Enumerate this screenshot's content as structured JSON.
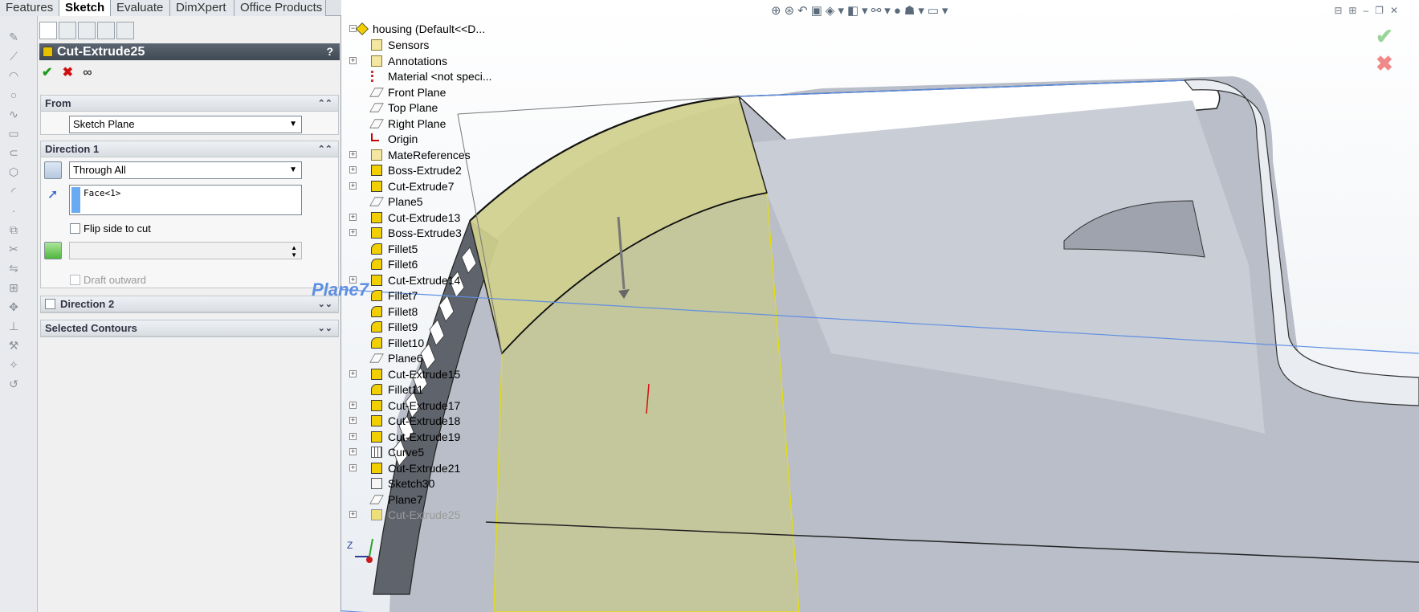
{
  "tabs": [
    {
      "label": "Features",
      "active": false
    },
    {
      "label": "Sketch",
      "active": true
    },
    {
      "label": "Evaluate",
      "active": false
    },
    {
      "label": "DimXpert",
      "active": false
    },
    {
      "label": "Office Products",
      "active": false
    }
  ],
  "property_manager": {
    "title": "Cut-Extrude25",
    "help": "?",
    "from": {
      "header": "From",
      "selected": "Sketch Plane"
    },
    "direction1": {
      "header": "Direction 1",
      "end_condition": "Through All",
      "face_selection": "Face<1>",
      "flip_side_label": "Flip side to cut",
      "draft_outward_label": "Draft outward"
    },
    "direction2": {
      "header": "Direction 2"
    },
    "selected_contours": {
      "header": "Selected Contours"
    }
  },
  "feature_tree": {
    "root": "housing  (Default<<D...",
    "items": [
      {
        "label": "Sensors",
        "icon": "sensor-icon",
        "expand": false
      },
      {
        "label": "Annotations",
        "icon": "annotations-icon",
        "expand": true
      },
      {
        "label": "Material <not speci...",
        "icon": "material-icon",
        "expand": false
      },
      {
        "label": "Front Plane",
        "icon": "plane-icon",
        "expand": false
      },
      {
        "label": "Top Plane",
        "icon": "plane-icon",
        "expand": false
      },
      {
        "label": "Right Plane",
        "icon": "plane-icon",
        "expand": false
      },
      {
        "label": "Origin",
        "icon": "origin-icon",
        "expand": false
      },
      {
        "label": "MateReferences",
        "icon": "folder-icon",
        "expand": true
      },
      {
        "label": "Boss-Extrude2",
        "icon": "extrude-icon",
        "expand": true
      },
      {
        "label": "Cut-Extrude7",
        "icon": "extrude-icon",
        "expand": true
      },
      {
        "label": "Plane5",
        "icon": "plane-icon",
        "expand": false
      },
      {
        "label": "Cut-Extrude13",
        "icon": "extrude-icon",
        "expand": true
      },
      {
        "label": "Boss-Extrude3",
        "icon": "extrude-icon",
        "expand": true
      },
      {
        "label": "Fillet5",
        "icon": "fillet-icon",
        "expand": false
      },
      {
        "label": "Fillet6",
        "icon": "fillet-icon",
        "expand": false
      },
      {
        "label": "Cut-Extrude14",
        "icon": "extrude-icon",
        "expand": true
      },
      {
        "label": "Fillet7",
        "icon": "fillet-icon",
        "expand": false
      },
      {
        "label": "Fillet8",
        "icon": "fillet-icon",
        "expand": false
      },
      {
        "label": "Fillet9",
        "icon": "fillet-icon",
        "expand": false
      },
      {
        "label": "Fillet10",
        "icon": "fillet-icon",
        "expand": false
      },
      {
        "label": "Plane6",
        "icon": "plane-icon",
        "expand": false
      },
      {
        "label": "Cut-Extrude15",
        "icon": "extrude-icon",
        "expand": true
      },
      {
        "label": "Fillet11",
        "icon": "fillet-icon",
        "expand": false
      },
      {
        "label": "Cut-Extrude17",
        "icon": "extrude-icon",
        "expand": true
      },
      {
        "label": "Cut-Extrude18",
        "icon": "extrude-icon",
        "expand": true
      },
      {
        "label": "Cut-Extrude19",
        "icon": "extrude-icon",
        "expand": true
      },
      {
        "label": "Curve5",
        "icon": "curve-icon",
        "expand": true
      },
      {
        "label": "Cut-Extrude21",
        "icon": "extrude-icon",
        "expand": true
      },
      {
        "label": "Sketch30",
        "icon": "sketch-icon",
        "expand": false
      },
      {
        "label": "Plane7",
        "icon": "plane-icon",
        "expand": false
      },
      {
        "label": "Cut-Extrude25",
        "icon": "extrude-icon",
        "expand": true,
        "gray": true
      }
    ]
  },
  "viewport": {
    "plane_label": "Plane7",
    "axis_z": "Z",
    "accent_plane": "#5f8fe2",
    "accent_extrude": "#c8c98a"
  }
}
